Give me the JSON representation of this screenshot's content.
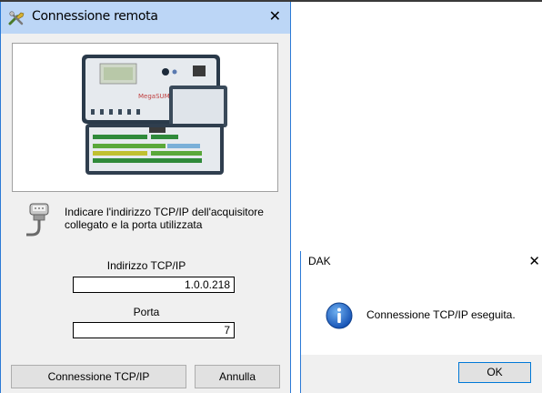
{
  "dialog_main": {
    "title": "Connessione remota",
    "device_brand": "MegaSUMI",
    "instruction": "Indicare l'indirizzo TCP/IP dell'acquisitore collegato e la porta utilizzata",
    "ip_label": "Indirizzo TCP/IP",
    "ip_value": "1.0.0.218",
    "port_label": "Porta",
    "port_value": "7",
    "connect_button": "Connessione TCP/IP",
    "cancel_button": "Annulla",
    "close_glyph": "✕"
  },
  "dialog_msg": {
    "title": "DAK",
    "message": "Connessione TCP/IP eseguita.",
    "ok_button": "OK",
    "close_glyph": "✕"
  },
  "colors": {
    "titlebar_active": "#bcd6f6",
    "window_border": "#2b7ad6",
    "info_blue": "#1b6fd1"
  },
  "icons": {
    "app": "wrench-screwdriver-icon",
    "serial": "serial-connector-icon",
    "info": "info-icon"
  }
}
